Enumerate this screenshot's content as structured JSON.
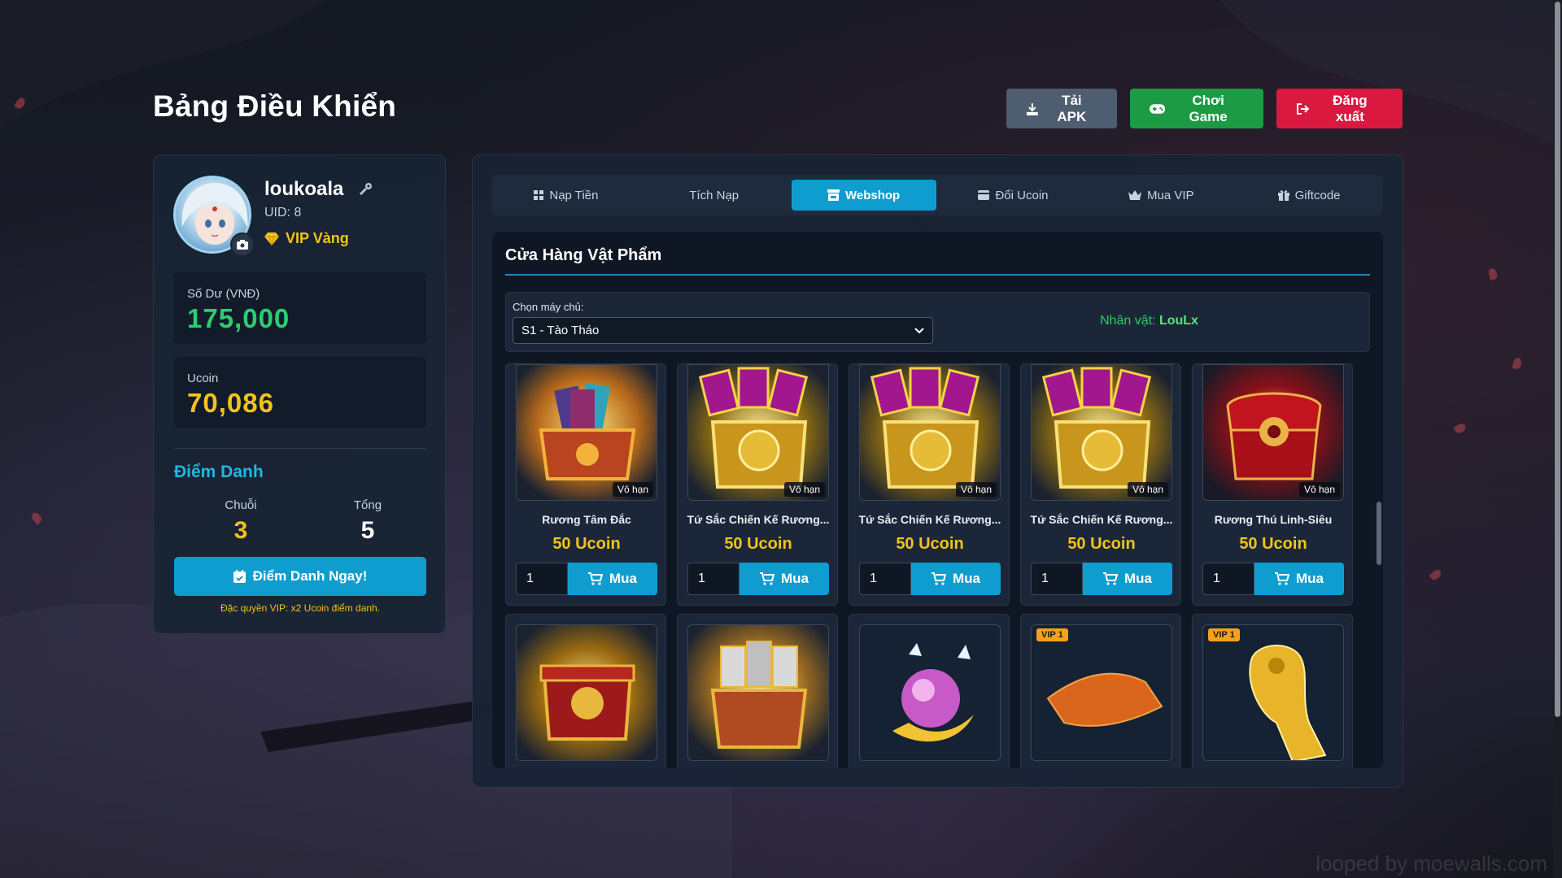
{
  "header": {
    "title": "Bảng Điều Khiển",
    "buttons": {
      "apk": "Tải APK",
      "play": "Chơi Game",
      "logout": "Đăng xuất"
    }
  },
  "profile": {
    "username": "loukoala",
    "uid": "UID: 8",
    "vip": "VIP Vàng",
    "balance_label": "Số Dư (VNĐ)",
    "balance_value": "175,000",
    "ucoin_label": "Ucoin",
    "ucoin_value": "70,086",
    "checkin_title": "Điểm Danh",
    "streak_label": "Chuỗi",
    "streak_value": "3",
    "total_label": "Tổng",
    "total_value": "5",
    "checkin_button": "Điểm Danh Ngay!",
    "checkin_note": "Đặc quyền VIP: x2 Ucoin điểm danh."
  },
  "tabs": [
    {
      "label": "Nạp Tiền",
      "icon": "grid-icon"
    },
    {
      "label": "Tích Nạp",
      "icon": ""
    },
    {
      "label": "Webshop",
      "icon": "store-icon",
      "active": true
    },
    {
      "label": "Đổi Ucoin",
      "icon": "wallet-icon"
    },
    {
      "label": "Mua VIP",
      "icon": "crown-icon"
    },
    {
      "label": "Giftcode",
      "icon": "gift-icon"
    }
  ],
  "shop": {
    "title": "Cửa Hàng Vật Phẩm",
    "server_label": "Chọn máy chủ:",
    "server_selected": "S1 - Tào Tháo",
    "character_label": "Nhân vật:",
    "character_name": "LouLx",
    "unlimited_badge": "Vô hạn",
    "buy_label": "Mua",
    "items": [
      {
        "name": "Rương Tâm Đắc",
        "price": "50 Ucoin",
        "qty": "1"
      },
      {
        "name": "Tứ Sắc Chiến Kế Rương...",
        "price": "50 Ucoin",
        "qty": "1"
      },
      {
        "name": "Tứ Sắc Chiến Kế Rương...",
        "price": "50 Ucoin",
        "qty": "1"
      },
      {
        "name": "Tứ Sắc Chiến Kế Rương...",
        "price": "50 Ucoin",
        "qty": "1"
      },
      {
        "name": "Rương Thú Linh-Siêu",
        "price": "50 Ucoin",
        "qty": "1"
      }
    ],
    "row2_badges": [
      "",
      "",
      "",
      "VIP 1",
      "VIP 1"
    ]
  },
  "watermark": "looped by moewalls.com",
  "colors": {
    "accent": "#0f9dd0",
    "balance": "#2ecc71",
    "ucoin": "#f5c21b",
    "checkin_title": "#22b7e4",
    "logout": "#d9193f",
    "play": "#1d9b44",
    "apk": "#4f5d70"
  }
}
